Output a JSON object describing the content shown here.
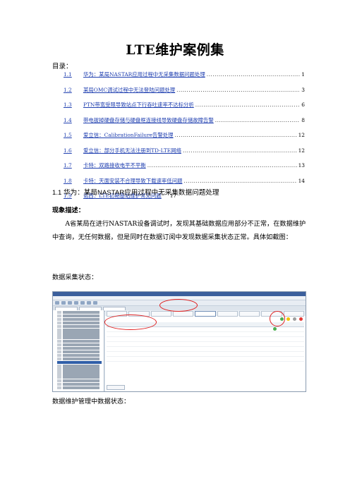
{
  "title": "LTE维护案例集",
  "toc_label": "目录：",
  "toc": [
    {
      "num": "1.1",
      "text": "华为：某局NASTAR应用过程中无采集数据问题处理",
      "page": "1"
    },
    {
      "num": "1.2",
      "text": "某局OMC调试过程中无法登陆问题处理",
      "page": "3"
    },
    {
      "num": "1.3",
      "text": "PTN带宽受限导致站点下行吞吐速率不达标分析",
      "page": "6"
    },
    {
      "num": "1.4",
      "text": "带电拔掉硬盘存储与硬盘框连接线导致硬盘存储故障告警",
      "page": "8"
    },
    {
      "num": "1.5",
      "text": "爱立信：CalibrationFailure告警处理",
      "page": "12"
    },
    {
      "num": "1.6",
      "text": "爱立信：部分手机无法注册到TD-LTE网络",
      "page": "12"
    },
    {
      "num": "1.7",
      "text": "卡特：双路接收电平不平衡",
      "page": "13"
    },
    {
      "num": "1.8",
      "text": "卡特：天面安装不合理导致下载速率低问题",
      "page": "14"
    },
    {
      "num": "1.9",
      "text": "诺西：LTE初期基站维护常见问题",
      "page": "17"
    }
  ],
  "section_heading": "1.1    华为：某局NASTAR应用过程中无采集数据问题处理",
  "phenomenon_label": "现象描述：",
  "paragraph": "A省某局在进行NASTAR设备调试时，发现其基础数据应用部分不正常，在数据维护中查询，无任何数据，但是同时在数据订阅中发现数据采集状态正常。具体如截图：",
  "caption_collection": "数据采集状态：",
  "caption_maintenance": "数据维护管理中数据状态：",
  "colors": {
    "link": "#1f3fb0",
    "annotation": "#e02020",
    "status_ok": "#4caf50",
    "status_warn": "#f2c200"
  }
}
